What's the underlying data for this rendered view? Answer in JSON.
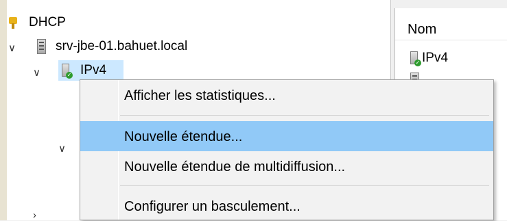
{
  "tree": {
    "root_label": "DHCP",
    "server_label": "srv-jbe-01.bahuet.local",
    "ipv4_label": "IPv4"
  },
  "list": {
    "column_name": "Nom",
    "items": [
      {
        "label": "IPv4"
      }
    ]
  },
  "context_menu": {
    "items": [
      {
        "label": "Afficher les statistiques..."
      },
      {
        "label": "Nouvelle étendue..."
      },
      {
        "label": "Nouvelle étendue de multidiffusion..."
      },
      {
        "label": "Configurer un basculement..."
      }
    ],
    "highlighted_index": 1
  },
  "colors": {
    "highlight": "#91c9f7",
    "tree_selection": "#cce8ff"
  }
}
